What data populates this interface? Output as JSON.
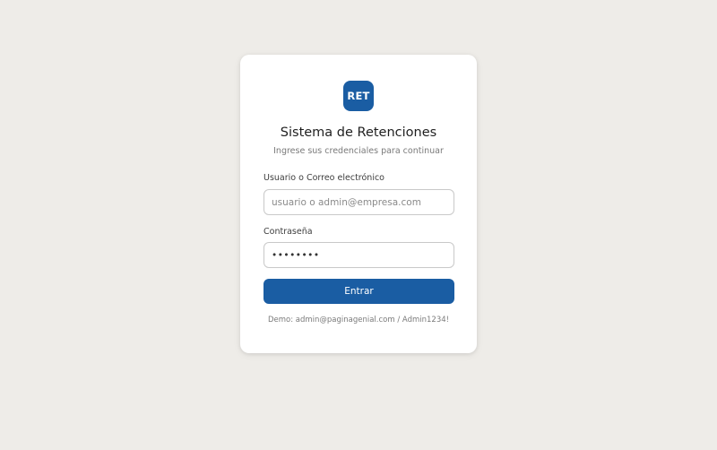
{
  "login": {
    "logo_text": "RET",
    "title": "Sistema de Retenciones",
    "subtitle": "Ingrese sus credenciales para continuar",
    "username": {
      "label": "Usuario o Correo electrónico",
      "placeholder": "usuario o admin@empresa.com",
      "value": ""
    },
    "password": {
      "label": "Contraseña",
      "value": "Admin12!"
    },
    "submit_label": "Entrar",
    "demo_hint": "Demo: admin@paginagenial.com / Admin1234!"
  },
  "colors": {
    "background": "#eeece8",
    "card": "#ffffff",
    "accent": "#1a5da3"
  }
}
